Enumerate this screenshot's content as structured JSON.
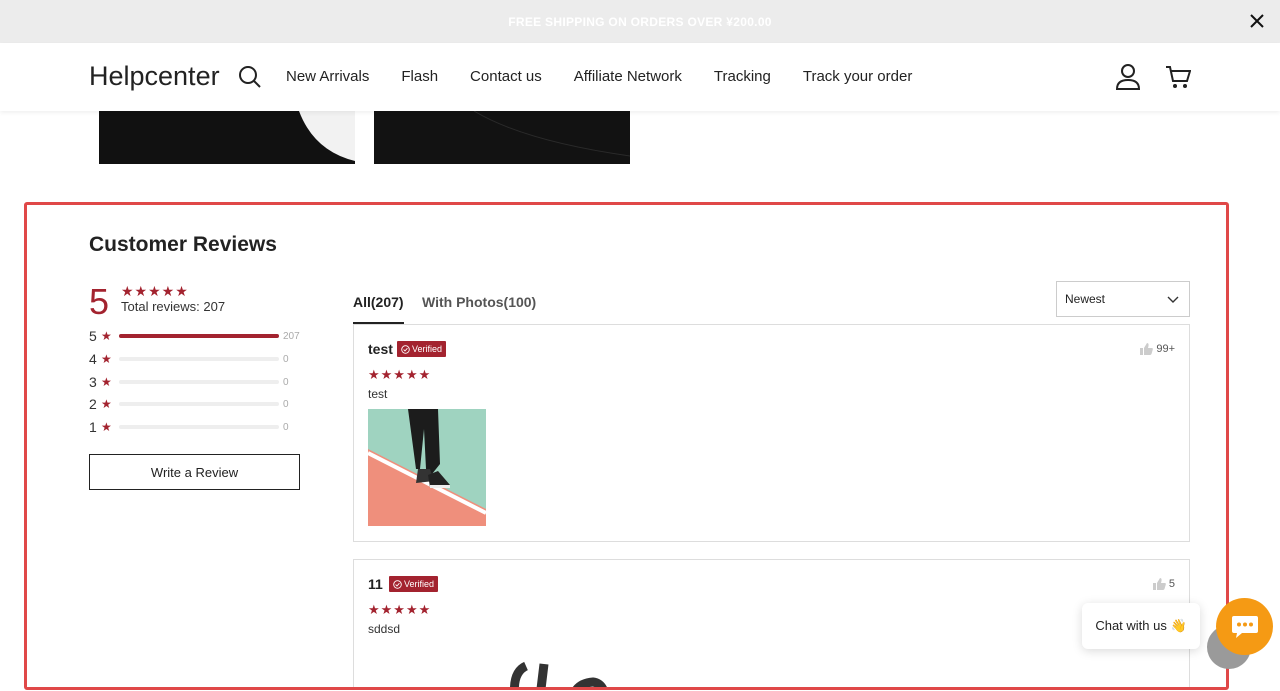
{
  "announcement": {
    "text": "FREE SHIPPING ON ORDERS OVER ¥200.00"
  },
  "header": {
    "logo": "Helpcenter",
    "nav": [
      "New Arrivals",
      "Flash",
      "Contact us",
      "Affiliate Network",
      "Tracking",
      "Track your order"
    ]
  },
  "reviews": {
    "title": "Customer Reviews",
    "score": "5",
    "total_label": "Total reviews: 207",
    "distribution": [
      {
        "stars": "5",
        "count": "207",
        "fraction": 1.0
      },
      {
        "stars": "4",
        "count": "0",
        "fraction": 0
      },
      {
        "stars": "3",
        "count": "0",
        "fraction": 0
      },
      {
        "stars": "2",
        "count": "0",
        "fraction": 0
      },
      {
        "stars": "1",
        "count": "0",
        "fraction": 0
      }
    ],
    "write_review": "Write a Review",
    "tabs": {
      "all": "All(207)",
      "photos": "With Photos(100)"
    },
    "sort": "Newest",
    "items": [
      {
        "name": "test",
        "verified": "Verified",
        "rating": 5,
        "text": "test",
        "likes": "99+"
      },
      {
        "name": "11",
        "verified": "Verified",
        "rating": 5,
        "text": "sddsd",
        "likes": "5"
      }
    ]
  },
  "chat": {
    "label": "Chat with us 👋"
  },
  "colors": {
    "accent": "#a3232f",
    "highlight_border": "#e04848",
    "chat": "#f59a14"
  }
}
